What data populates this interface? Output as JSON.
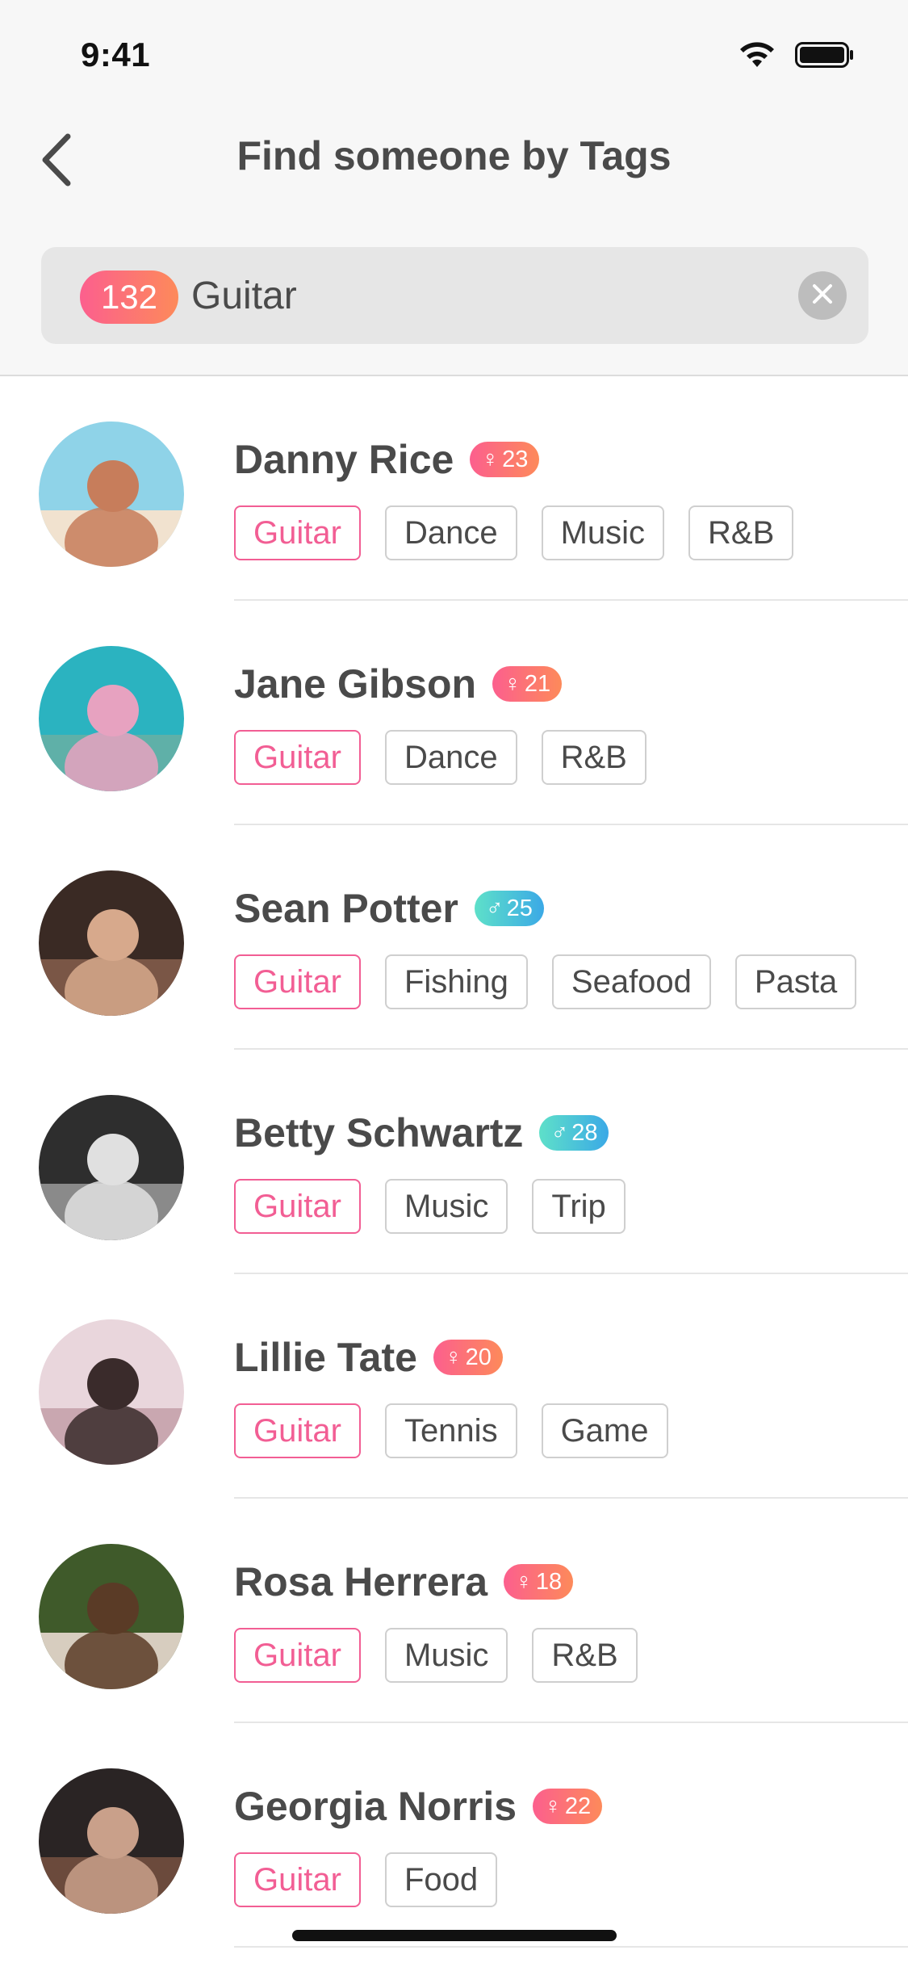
{
  "status_bar": {
    "time": "9:41",
    "icons": [
      "wifi-icon",
      "battery-icon"
    ]
  },
  "nav": {
    "back_icon": "chevron-left-icon",
    "title": "Find someone by Tags"
  },
  "search": {
    "count": "132",
    "query": "Guitar",
    "clear_icon": "close-icon"
  },
  "colors": {
    "accent_pink": "#f25e94",
    "female_gradient": [
      "#fc5f8e",
      "#fd8a5a"
    ],
    "male_gradient": [
      "#5ee0c9",
      "#3ba9e6"
    ]
  },
  "people": [
    {
      "name": "Danny Rice",
      "gender": "female",
      "gender_symbol": "♀",
      "age": "23",
      "tags": [
        "Guitar",
        "Dance",
        "Music",
        "R&B"
      ]
    },
    {
      "name": "Jane Gibson",
      "gender": "female",
      "gender_symbol": "♀",
      "age": "21",
      "tags": [
        "Guitar",
        "Dance",
        "R&B"
      ]
    },
    {
      "name": "Sean Potter",
      "gender": "male",
      "gender_symbol": "♂",
      "age": "25",
      "tags": [
        "Guitar",
        "Fishing",
        "Seafood",
        "Pasta"
      ]
    },
    {
      "name": "Betty Schwartz",
      "gender": "male",
      "gender_symbol": "♂",
      "age": "28",
      "tags": [
        "Guitar",
        "Music",
        "Trip"
      ]
    },
    {
      "name": "Lillie Tate",
      "gender": "female",
      "gender_symbol": "♀",
      "age": "20",
      "tags": [
        "Guitar",
        "Tennis",
        "Game"
      ]
    },
    {
      "name": "Rosa Herrera",
      "gender": "female",
      "gender_symbol": "♀",
      "age": "18",
      "tags": [
        "Guitar",
        "Music",
        "R&B"
      ]
    },
    {
      "name": "Georgia Norris",
      "gender": "female",
      "gender_symbol": "♀",
      "age": "22",
      "tags": [
        "Guitar",
        "Food"
      ]
    }
  ]
}
